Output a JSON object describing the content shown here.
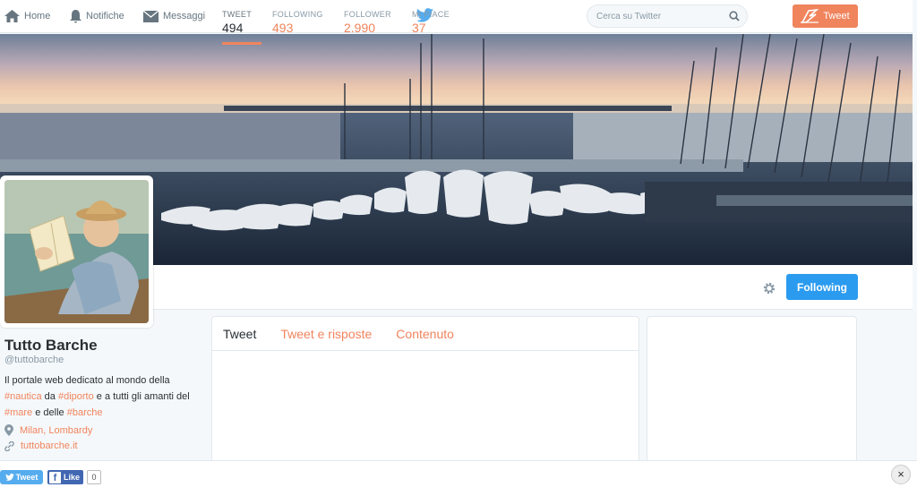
{
  "nav": {
    "home": "Home",
    "notifications": "Notifiche",
    "messages": "Messaggi",
    "search_placeholder": "Cerca su Twitter",
    "tweet_button": "Tweet"
  },
  "stats": [
    {
      "label": "TWEET",
      "value": "494"
    },
    {
      "label": "FOLLOWING",
      "value": "493"
    },
    {
      "label": "FOLLOWER",
      "value": "2.990"
    },
    {
      "label": "MI PIACE",
      "value": "37"
    }
  ],
  "follow_button": "Following",
  "profile": {
    "name": "Tutto Barche",
    "handle": "@tuttobarche",
    "bio": {
      "t1": "Il portale web dedicato al mondo della ",
      "h1": "#nautica",
      "t2": " da ",
      "h2": "#diporto",
      "t3": " e a tutti gli amanti del ",
      "h3": "#mare",
      "t4": " e delle ",
      "h4": "#barche"
    },
    "location": "Milan, Lombardy",
    "website": "tuttobarche.it"
  },
  "tabs": [
    "Tweet",
    "Tweet e risposte",
    "Contenuto"
  ],
  "share": {
    "tweet": "Tweet",
    "like": "Like",
    "like_count": "0",
    "close": "×"
  },
  "colors": {
    "accent": "#f0845d",
    "follow_blue": "#2b9bf0",
    "twitter_blue": "#55acee"
  }
}
